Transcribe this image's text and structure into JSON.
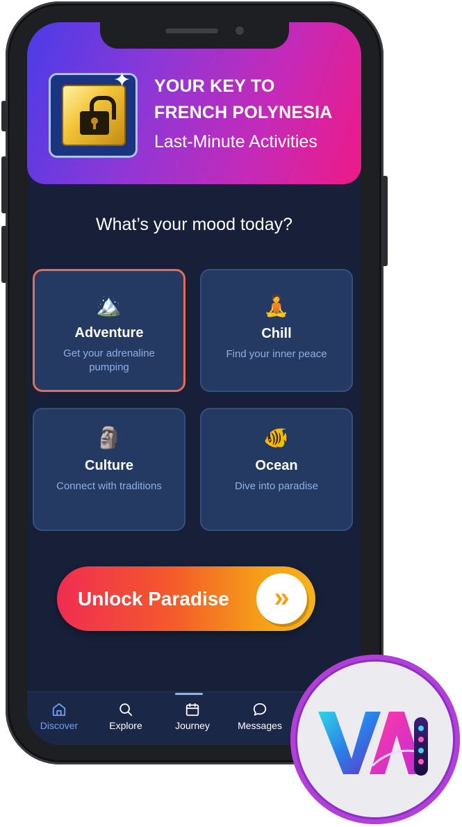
{
  "header": {
    "title_line1": "YOUR KEY TO",
    "title_line2": "FRENCH POLYNESIA",
    "subtitle": "Last-Minute Activities"
  },
  "mood": {
    "question": "What’s your mood today?",
    "options": [
      {
        "emoji": "🏔️",
        "name": "Adventure",
        "description": "Get your adrenaline pumping",
        "selected": true
      },
      {
        "emoji": "🧘",
        "name": "Chill",
        "description": "Find your inner peace",
        "selected": false
      },
      {
        "emoji": "🗿",
        "name": "Culture",
        "description": "Connect with traditions",
        "selected": false
      },
      {
        "emoji": "🐠",
        "name": "Ocean",
        "description": "Dive into paradise",
        "selected": false
      }
    ]
  },
  "cta": {
    "label": "Unlock Paradise",
    "icon": "double-chevron-right-icon"
  },
  "tabbar": {
    "tabs": [
      {
        "label": "Discover",
        "icon": "home-icon",
        "active": true
      },
      {
        "label": "Explore",
        "icon": "search-icon",
        "active": false
      },
      {
        "label": "Journey",
        "icon": "calendar-icon",
        "active": false
      },
      {
        "label": "Messages",
        "icon": "chat-bubble-icon",
        "active": false
      }
    ]
  },
  "colors": {
    "header_gradient": [
      "#4a3ce8",
      "#ee1a86"
    ],
    "screen_bg": "#172038",
    "card_bg": "#243a63",
    "selected_border": "#e46b55",
    "cta_gradient": [
      "#f02d52",
      "#f5b21a"
    ],
    "active_tab": "#6fa0f0"
  }
}
